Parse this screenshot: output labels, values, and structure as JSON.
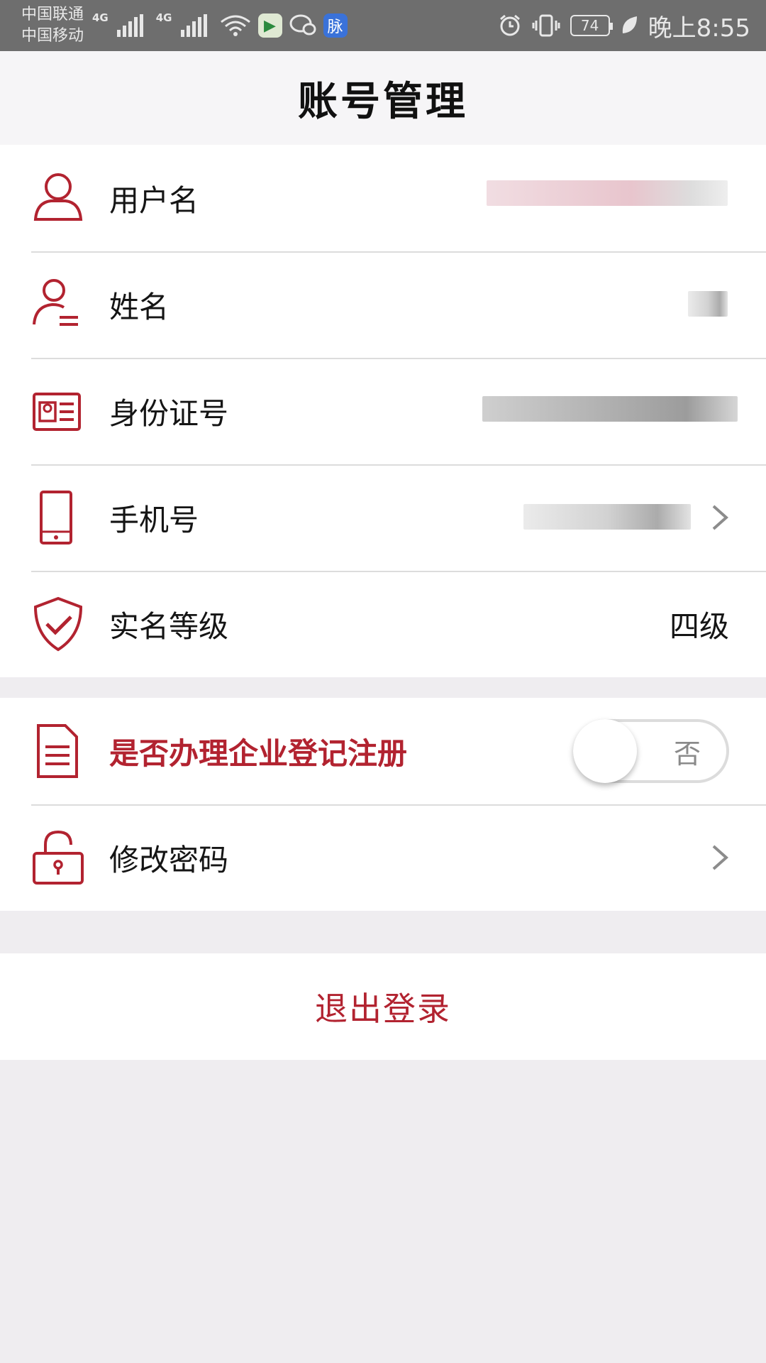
{
  "status_bar": {
    "carrier_1": "中国联通",
    "carrier_2": "中国移动",
    "net_1": "4G",
    "net_2": "4G",
    "app_badge": "脉",
    "battery": "74",
    "time": "晚上8:55"
  },
  "header": {
    "title": "账号管理"
  },
  "account_rows": [
    {
      "label": "用户名",
      "icon": "user-icon"
    },
    {
      "label": "姓名",
      "icon": "person-name-icon"
    },
    {
      "label": "身份证号",
      "icon": "id-card-icon"
    },
    {
      "label": "手机号",
      "icon": "phone-icon"
    },
    {
      "label": "实名等级",
      "icon": "shield-check-icon",
      "value": "四级"
    }
  ],
  "settings_rows": {
    "enterprise": {
      "label": "是否办理企业登记注册",
      "icon": "document-icon",
      "toggle_text": "否",
      "toggle_on": false
    },
    "password": {
      "label": "修改密码",
      "icon": "lock-icon"
    }
  },
  "logout": {
    "label": "退出登录"
  },
  "colors": {
    "accent": "#b22330",
    "background": "#efedf0",
    "status_bar": "#6e6e6e"
  }
}
